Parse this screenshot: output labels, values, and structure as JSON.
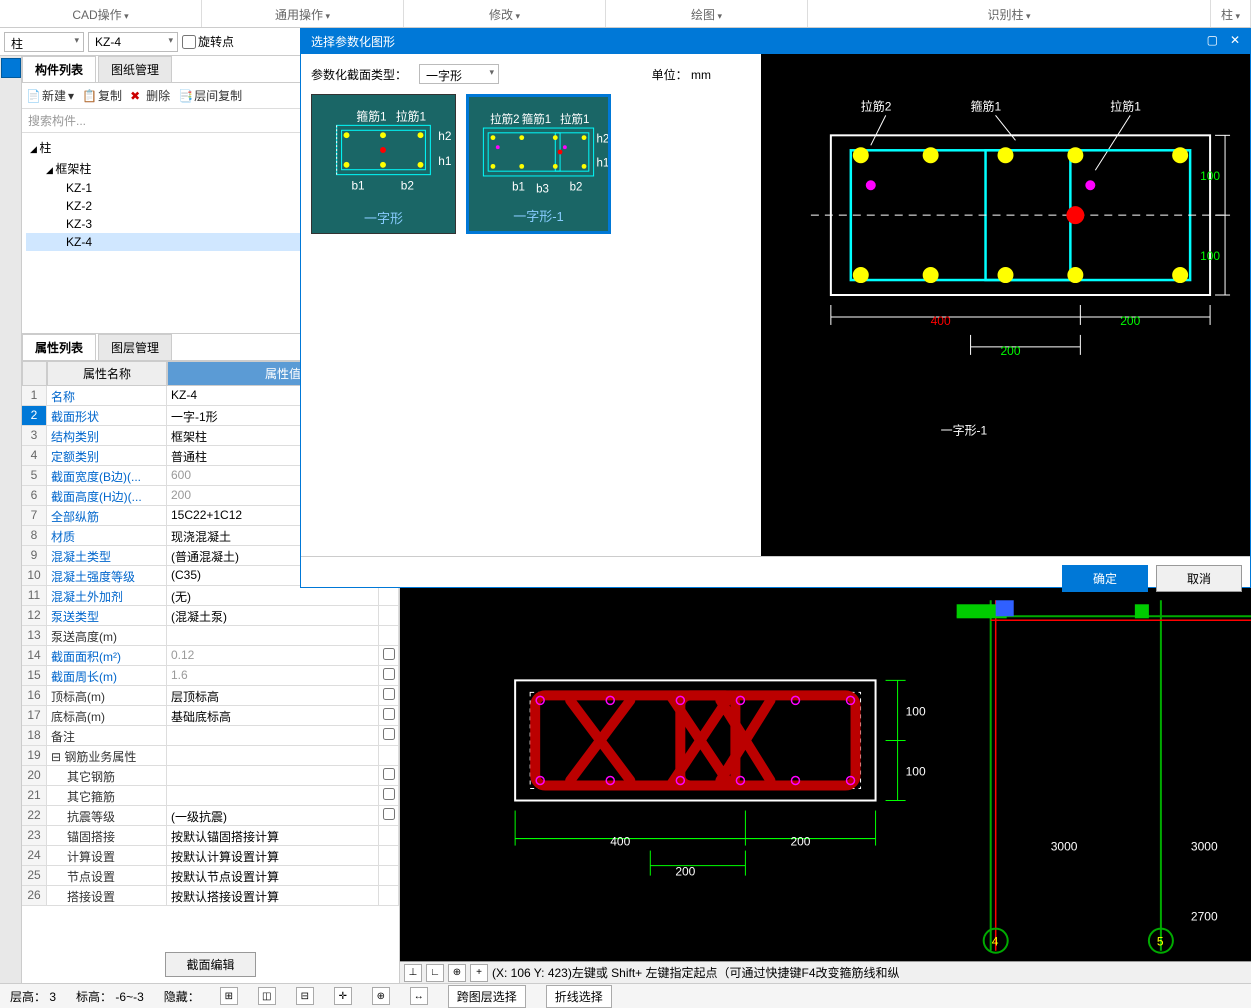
{
  "ribbon": [
    "CAD操作",
    "通用操作",
    "修改",
    "绘图",
    "识别柱",
    "柱"
  ],
  "toolbar": {
    "combo1": "柱",
    "combo2": "KZ-4",
    "chk1": "旋转点"
  },
  "panelTabs": {
    "list": "构件列表",
    "paper": "图纸管理"
  },
  "panelToolbar": {
    "new": "新建",
    "copy": "复制",
    "del": "删除",
    "floorCopy": "层间复制"
  },
  "search": "搜索构件...",
  "tree": {
    "root": "柱",
    "sub": "框架柱",
    "items": [
      "KZ-1",
      "KZ-2",
      "KZ-3",
      "KZ-4"
    ],
    "selected": "KZ-4"
  },
  "propTabs": {
    "prop": "属性列表",
    "layer": "图层管理"
  },
  "propHeader": {
    "name": "属性名称",
    "val": "属性值"
  },
  "props": [
    {
      "n": "1",
      "name": "名称",
      "val": "KZ-4",
      "link": true
    },
    {
      "n": "2",
      "name": "截面形状",
      "val": "一字-1形",
      "link": true,
      "sel": true,
      "btn": true
    },
    {
      "n": "3",
      "name": "结构类别",
      "val": "框架柱",
      "link": true
    },
    {
      "n": "4",
      "name": "定额类别",
      "val": "普通柱",
      "link": true
    },
    {
      "n": "5",
      "name": "截面宽度(B边)(...",
      "val": "600",
      "link": true,
      "gray": true
    },
    {
      "n": "6",
      "name": "截面高度(H边)(...",
      "val": "200",
      "link": true,
      "gray": true
    },
    {
      "n": "7",
      "name": "全部纵筋",
      "val": "15C22+1C12",
      "link": true
    },
    {
      "n": "8",
      "name": "材质",
      "val": "现浇混凝土",
      "link": true
    },
    {
      "n": "9",
      "name": "混凝土类型",
      "val": "(普通混凝土)",
      "link": true
    },
    {
      "n": "10",
      "name": "混凝土强度等级",
      "val": "(C35)",
      "link": true
    },
    {
      "n": "11",
      "name": "混凝土外加剂",
      "val": "(无)",
      "link": true
    },
    {
      "n": "12",
      "name": "泵送类型",
      "val": "(混凝土泵)",
      "link": true
    },
    {
      "n": "13",
      "name": "泵送高度(m)",
      "val": ""
    },
    {
      "n": "14",
      "name": "截面面积(m²)",
      "val": "0.12",
      "link": true,
      "gray": true,
      "chk": true
    },
    {
      "n": "15",
      "name": "截面周长(m)",
      "val": "1.6",
      "link": true,
      "gray": true,
      "chk": true
    },
    {
      "n": "16",
      "name": "顶标高(m)",
      "val": "层顶标高",
      "chk": true
    },
    {
      "n": "17",
      "name": "底标高(m)",
      "val": "基础底标高",
      "chk": true
    },
    {
      "n": "18",
      "name": "备注",
      "val": "",
      "chk": true
    },
    {
      "n": "19",
      "name": "钢筋业务属性",
      "val": "",
      "group": true
    },
    {
      "n": "20",
      "name": "其它钢筋",
      "val": "",
      "indent": true,
      "chk": true
    },
    {
      "n": "21",
      "name": "其它箍筋",
      "val": "",
      "indent": true,
      "chk": true
    },
    {
      "n": "22",
      "name": "抗震等级",
      "val": "(一级抗震)",
      "indent": true,
      "chk": true
    },
    {
      "n": "23",
      "name": "锚固搭接",
      "val": "按默认锚固搭接计算",
      "indent": true
    },
    {
      "n": "24",
      "name": "计算设置",
      "val": "按默认计算设置计算",
      "indent": true
    },
    {
      "n": "25",
      "name": "节点设置",
      "val": "按默认节点设置计算",
      "indent": true
    },
    {
      "n": "26",
      "name": "搭接设置",
      "val": "按默认搭接设置计算",
      "indent": true
    }
  ],
  "editBtn": "截面编辑",
  "dialog": {
    "title": "选择参数化图形",
    "typeLabel": "参数化截面类型：",
    "typeValue": "一字形",
    "unitLabel": "单位：",
    "unitValue": "mm",
    "shapes": [
      "一字形",
      "一字形-1"
    ],
    "preview": {
      "labels": {
        "lj2": "拉筋2",
        "gj1": "箍筋1",
        "lj1": "拉筋1"
      },
      "dims": {
        "t100": "100",
        "b100": "100",
        "w400": "400",
        "w200r": "200",
        "w200b": "200"
      },
      "name": "一字形-1"
    },
    "ok": "确定",
    "cancel": "取消"
  },
  "canvas": {
    "dims": {
      "t100": "100",
      "b100": "100",
      "w400": "400",
      "w200": "200",
      "w200r": "200",
      "g3000": "3000",
      "g3000r": "3000",
      "g2700": "2700"
    },
    "axes": {
      "a4": "4",
      "a5": "5"
    },
    "status": "(X: 106 Y: 423)左键或 Shift+ 左键指定起点（可通过快捷键F4改变箍筋线和纵"
  },
  "statusbar": {
    "floor": "层高：",
    "floorV": "3",
    "elev": "标高：",
    "elevV": "-6~-3",
    "hide": "隐藏：",
    "crossFloor": "跨图层选择",
    "polyline": "折线选择"
  }
}
